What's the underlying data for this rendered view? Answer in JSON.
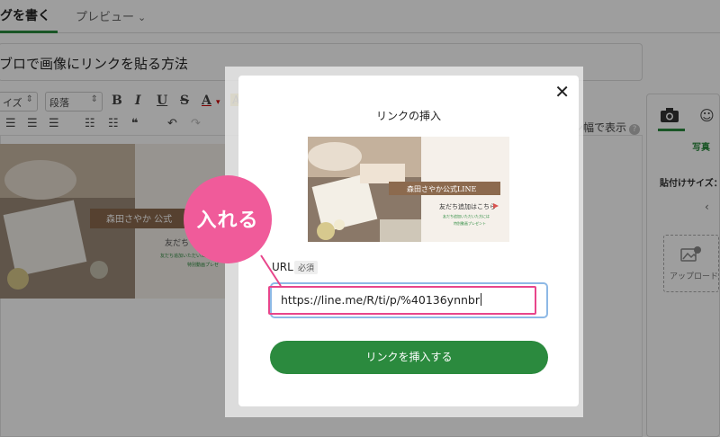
{
  "editor": {
    "tab_write": "グを書く",
    "tab_preview": "プレビュー",
    "title": "ブロで画像にリンクを貼る方法",
    "font_size_select": "イズ",
    "paragraph_select": "段落",
    "wide_view_label": "ン幅で表示",
    "help_icon": "?"
  },
  "side_panel": {
    "photo_tab": "写真",
    "paste_size_label": "貼付けサイズ：",
    "upload_label": "アップロード",
    "nav_arrow": "‹"
  },
  "dialog": {
    "title": "リンクの挿入",
    "close_label": "✕",
    "url_label": "URL",
    "required_badge": "必須",
    "url_value": "https://line.me/R/ti/p/%40136ynnbr",
    "submit_label": "リンクを挿入する"
  },
  "preview_card": {
    "title": "森田さやか公式LINE",
    "line1": "友だち追加はこちら",
    "line2": "友だち追加いただいた方には",
    "line3": "特別動画プレゼント"
  },
  "background_card": {
    "title": "森田さやか 公式",
    "line1": "友だち",
    "line2": "友だち追加いただいた方には",
    "line3": "特別動画プレゼ"
  },
  "annotation": {
    "text": "入れる",
    "color": "#f05b9a"
  },
  "colors": {
    "accent": "#2b8a3e",
    "highlight": "#e8458b"
  }
}
